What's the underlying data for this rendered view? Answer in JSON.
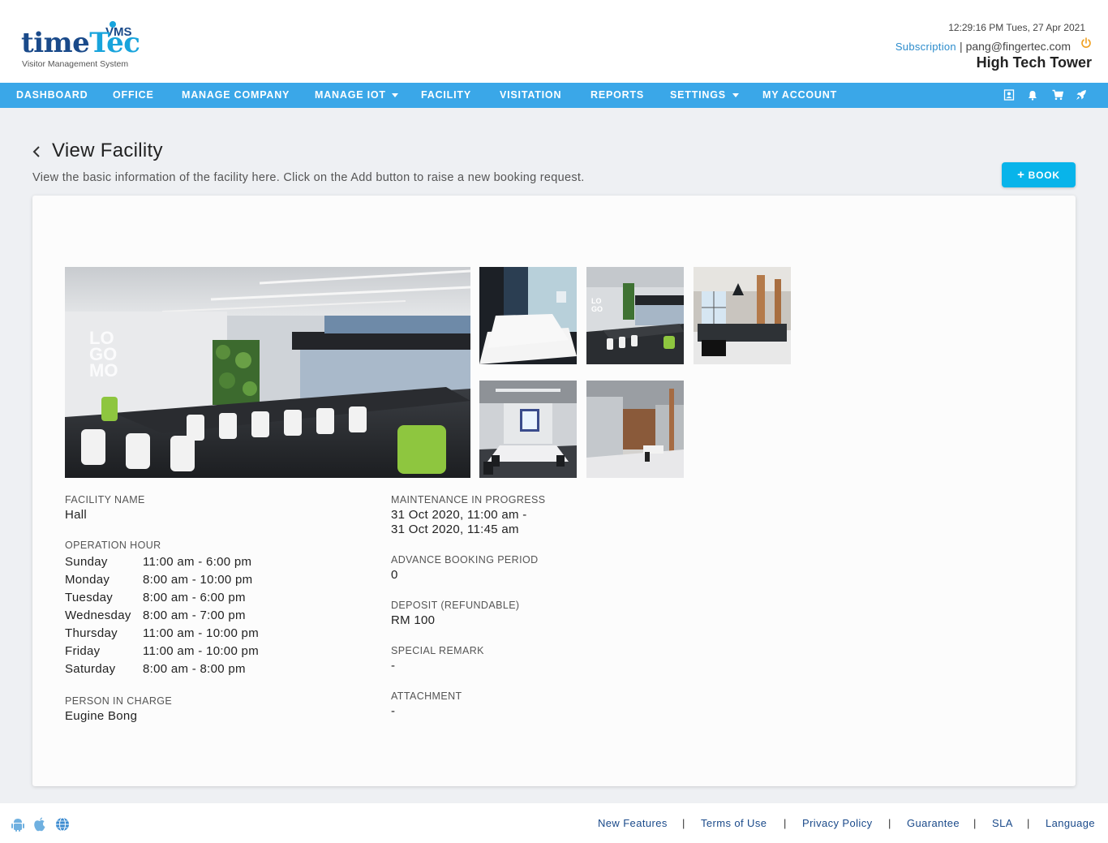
{
  "header": {
    "logo_word_1": "time",
    "logo_word_2": "Tec",
    "logo_badge": "VMS",
    "logo_subtitle": "Visitor Management System",
    "datetime": "12:29:16 PM  Tues, 27 Apr 2021",
    "subscription_label": "Subscription",
    "separator": "|",
    "email": "pang@fingertec.com",
    "company": "High Tech Tower"
  },
  "nav": {
    "items": [
      "DASHBOARD",
      "OFFICE",
      "MANAGE COMPANY",
      "MANAGE IOT",
      "FACILITY",
      "VISITATION",
      "REPORTS",
      "SETTINGS",
      "MY ACCOUNT"
    ],
    "icons": [
      "contact-card-icon",
      "notification-bell-icon",
      "cart-icon",
      "rocket-icon"
    ],
    "notification_color": "#e00000"
  },
  "page": {
    "title": "View Facility",
    "subtitle": "View the basic information of the facility here. Click on the Add button to raise a new booking request.",
    "book_label": "BOOK"
  },
  "facility": {
    "name_label": "FACILITY NAME",
    "name": "Hall",
    "operation_label": "OPERATION HOUR",
    "hours": [
      {
        "day": "Sunday",
        "time": "11:00 am - 6:00 pm"
      },
      {
        "day": "Monday",
        "time": "8:00 am - 10:00 pm"
      },
      {
        "day": "Tuesday",
        "time": "8:00 am - 6:00 pm"
      },
      {
        "day": "Wednesday",
        "time": "8:00 am - 7:00 pm"
      },
      {
        "day": "Thursday",
        "time": "11:00 am - 10:00 pm"
      },
      {
        "day": "Friday",
        "time": "11:00 am - 10:00 pm"
      },
      {
        "day": "Saturday",
        "time": "8:00 am - 8:00 pm"
      }
    ],
    "pic_label": "PERSON IN CHARGE",
    "pic": "Eugine Bong",
    "maintenance_label": "MAINTENANCE IN PROGRESS",
    "maintenance_line1": "31 Oct 2020, 11:00 am -",
    "maintenance_line2": "31 Oct 2020, 11:45 am",
    "advance_label": "ADVANCE BOOKING PERIOD",
    "advance": "0",
    "deposit_label": "DEPOSIT (REFUNDABLE)",
    "deposit": "RM 100",
    "remark_label": "SPECIAL REMARK",
    "remark": "-",
    "attachment_label": "ATTACHMENT",
    "attachment": "-",
    "wall_logo": "LOGOMO"
  },
  "footer": {
    "icons": [
      "android-icon",
      "apple-icon",
      "globe-icon"
    ],
    "links": [
      "New Features",
      "Terms of Use",
      "Privacy Policy",
      "Guarantee",
      "SLA",
      "Language"
    ],
    "separator": "|"
  }
}
